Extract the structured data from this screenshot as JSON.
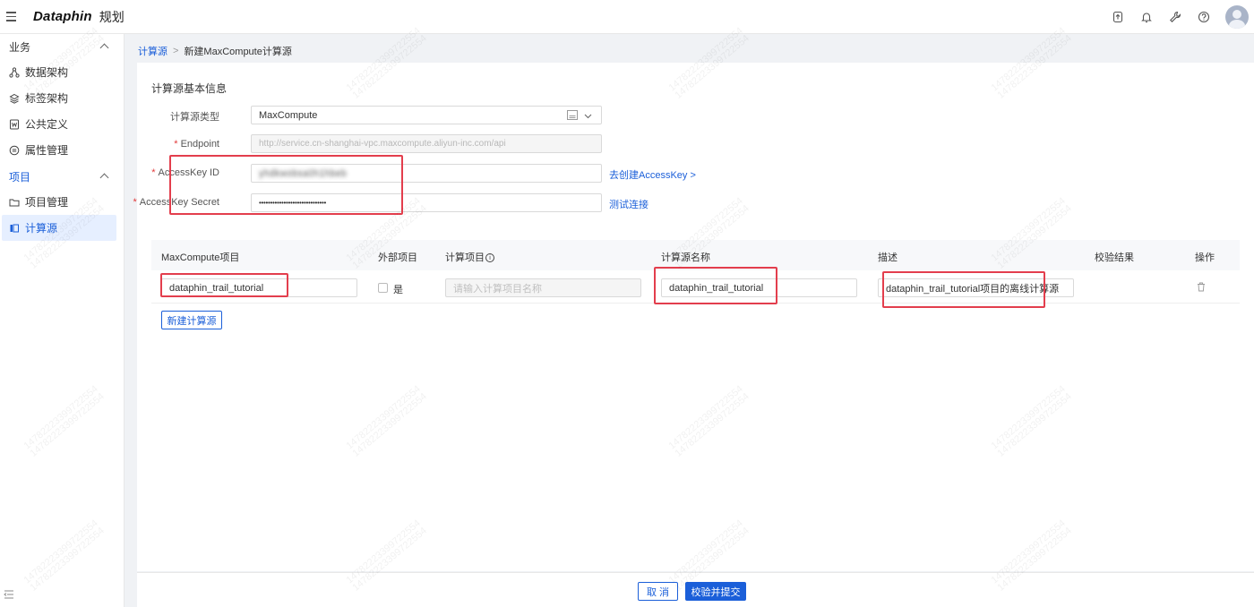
{
  "app": {
    "logo": "Dataphin",
    "module": "规划"
  },
  "colors": {
    "accent": "#1b5fd9",
    "highlight": "#e33e4d",
    "required": "#e23a3a"
  },
  "topbar_icons": [
    "upgrade-icon",
    "bell-icon",
    "wrench-icon",
    "help-icon",
    "user-avatar"
  ],
  "sidebar": {
    "groups": [
      {
        "title": "业务",
        "items": [
          {
            "label": "数据架构",
            "icon": "architecture-icon"
          },
          {
            "label": "标签架构",
            "icon": "layers-icon"
          },
          {
            "label": "公共定义",
            "icon": "document-icon"
          },
          {
            "label": "属性管理",
            "icon": "attribute-icon"
          }
        ]
      },
      {
        "title": "项目",
        "items": [
          {
            "label": "项目管理",
            "icon": "folder-icon"
          },
          {
            "label": "计算源",
            "icon": "compute-source-icon",
            "active": true
          }
        ]
      }
    ]
  },
  "breadcrumb": {
    "parent": "计算源",
    "separator": ">",
    "current": "新建MaxCompute计算源"
  },
  "form": {
    "section_title": "计算源基本信息",
    "type": {
      "label": "计算源类型",
      "value": "MaxCompute"
    },
    "endpoint": {
      "label": "Endpoint",
      "placeholder": "http://service.cn-shanghai-vpc.maxcompute.aliyun-inc.com/api"
    },
    "access_key_id": {
      "label": "AccessKey ID",
      "value": "yhdkwobsa0h1hbeb",
      "link": "去创建AccessKey >"
    },
    "access_key_secret": {
      "label": "AccessKey Secret",
      "value": "••••••••••••••••••••••••••••••",
      "link": "测试连接"
    }
  },
  "table": {
    "headers": [
      "MaxCompute项目",
      "外部项目",
      "计算项目",
      "计算源名称",
      "描述",
      "校验结果",
      "操作"
    ],
    "rows": [
      {
        "project": "dataphin_trail_tutorial",
        "external_label": "是",
        "compute_project_placeholder": "请输入计算项目名称",
        "source_name": "dataphin_trail_tutorial",
        "description": "dataphin_trail_tutorial项目的离线计算源"
      }
    ],
    "add_button": "新建计算源"
  },
  "footer": {
    "cancel": "取 消",
    "submit": "校验并提交"
  },
  "watermark": "14782223399722554"
}
